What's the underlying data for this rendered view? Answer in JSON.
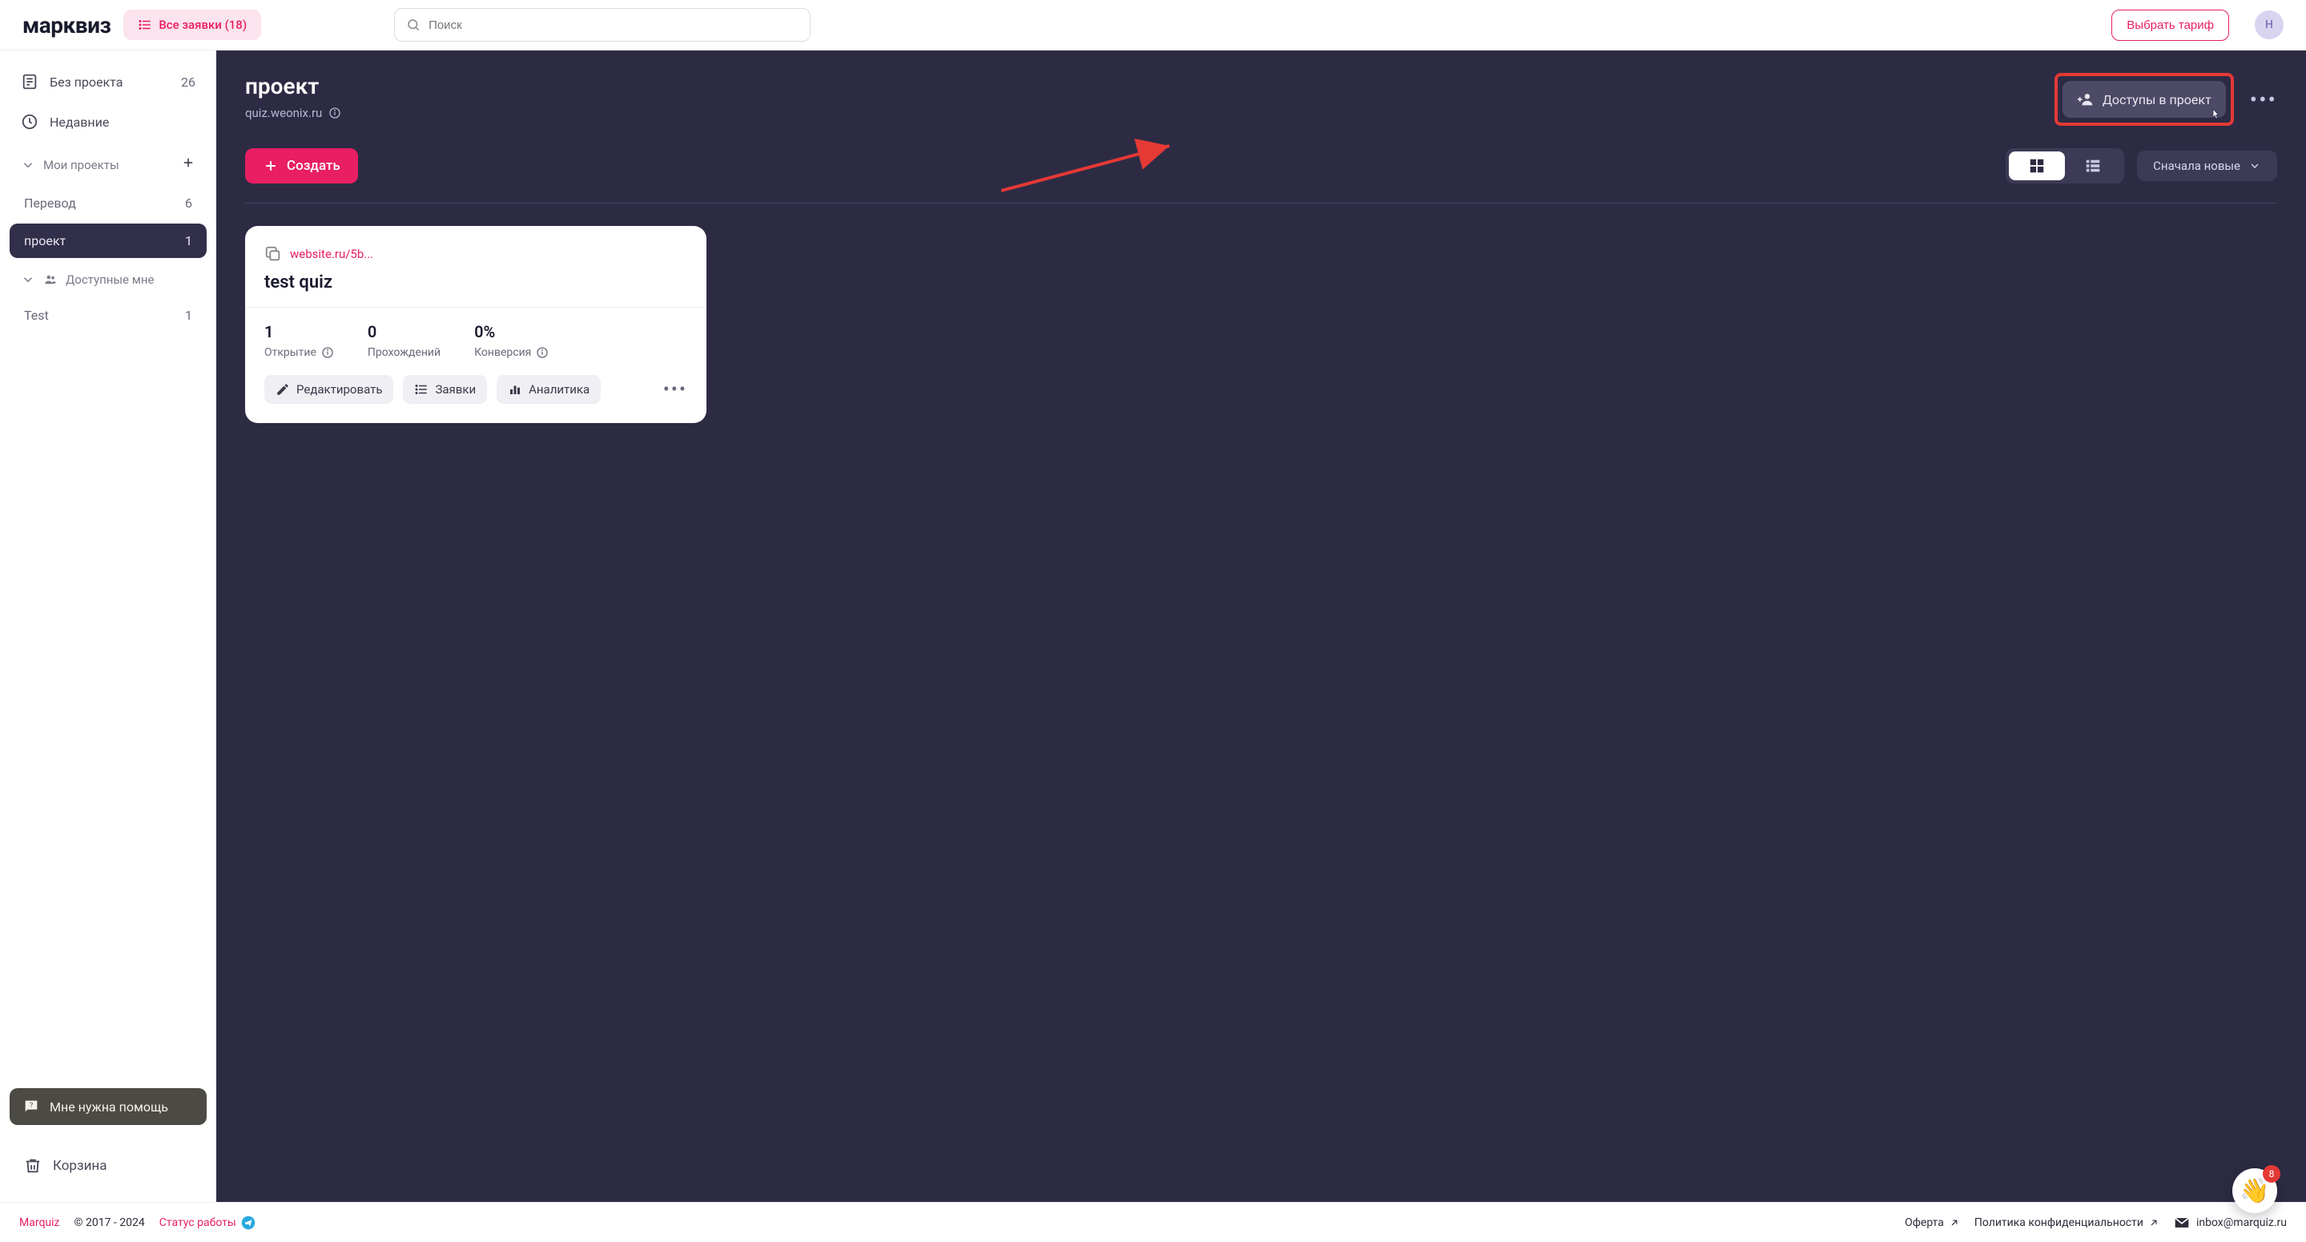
{
  "header": {
    "logo": "марквиз",
    "all_requests": "Все заявки (18)",
    "search_placeholder": "Поиск",
    "select_plan": "Выбрать тариф",
    "avatar_initial": "Н"
  },
  "sidebar": {
    "no_project": {
      "label": "Без проекта",
      "count": "26"
    },
    "recent": {
      "label": "Недавние"
    },
    "my_projects_header": "Мои проекты",
    "projects": [
      {
        "label": "Перевод",
        "count": "6"
      },
      {
        "label": "проект",
        "count": "1"
      }
    ],
    "shared_header": "Доступные мне",
    "shared": [
      {
        "label": "Test",
        "count": "1"
      }
    ],
    "help": "Мне нужна помощь",
    "trash": "Корзина"
  },
  "main": {
    "title": "проект",
    "subtitle": "quiz.weonix.ru",
    "access_btn": "Доступы в проект",
    "create": "Создать",
    "sort": "Сначала новые",
    "card": {
      "url": "website.ru/5b...",
      "title": "test quiz",
      "stats": [
        {
          "value": "1",
          "label": "Открытие"
        },
        {
          "value": "0",
          "label": "Прохождений"
        },
        {
          "value": "0%",
          "label": "Конверсия"
        }
      ],
      "edit": "Редактировать",
      "requests": "Заявки",
      "analytics": "Аналитика"
    }
  },
  "footer": {
    "brand": "Marquiz",
    "copyright": "© 2017 - 2024",
    "status": "Статус работы",
    "offer": "Оферта",
    "privacy": "Политика конфиденциальности",
    "email": "inbox@marquiz.ru"
  },
  "fab": {
    "badge": "8"
  }
}
